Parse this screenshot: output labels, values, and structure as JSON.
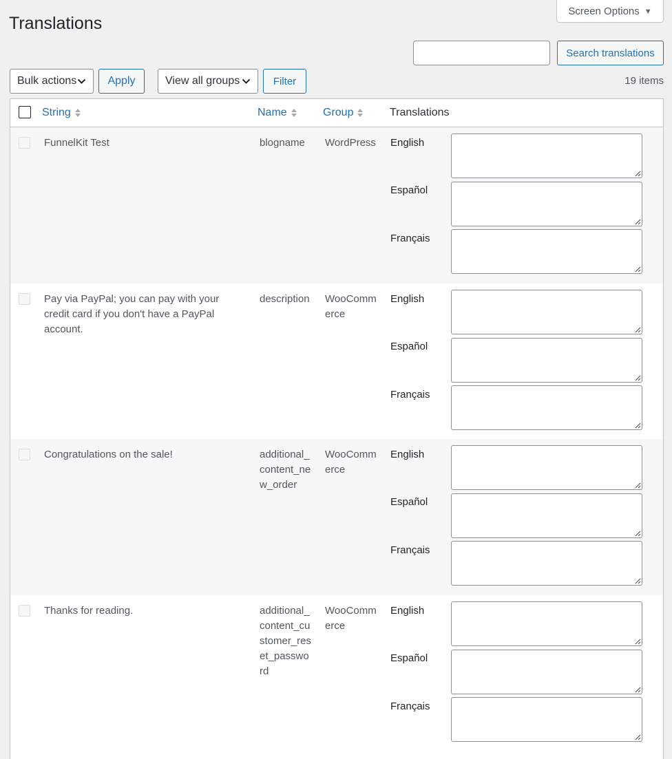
{
  "header": {
    "screen_options_label": "Screen Options",
    "page_title": "Translations"
  },
  "search": {
    "placeholder": "",
    "value": "",
    "button_label": "Search translations"
  },
  "toolbar": {
    "bulk_actions_label": "Bulk actions",
    "apply_label": "Apply",
    "groups_label": "View all groups",
    "filter_label": "Filter",
    "items_count": "19 items"
  },
  "table": {
    "columns": {
      "string": "String",
      "name": "Name",
      "group": "Group",
      "translations": "Translations"
    },
    "languages": [
      "English",
      "Español",
      "Français"
    ],
    "rows": [
      {
        "string": "FunnelKit Test",
        "name": "blogname",
        "group": "WordPress"
      },
      {
        "string": "Pay via PayPal; you can pay with your credit card if you don't have a PayPal account.",
        "name": "description",
        "group": "WooCommerce"
      },
      {
        "string": "Congratulations on the sale!",
        "name": "additional_content_new_order",
        "group": "WooCommerce"
      },
      {
        "string": "Thanks for reading.",
        "name": "additional_content_customer_reset_password",
        "group": "WooCommerce"
      }
    ]
  },
  "colors": {
    "accent": "#2271b1",
    "page_bg": "#f0f0f1",
    "row_alt_bg": "#f6f7f7"
  }
}
